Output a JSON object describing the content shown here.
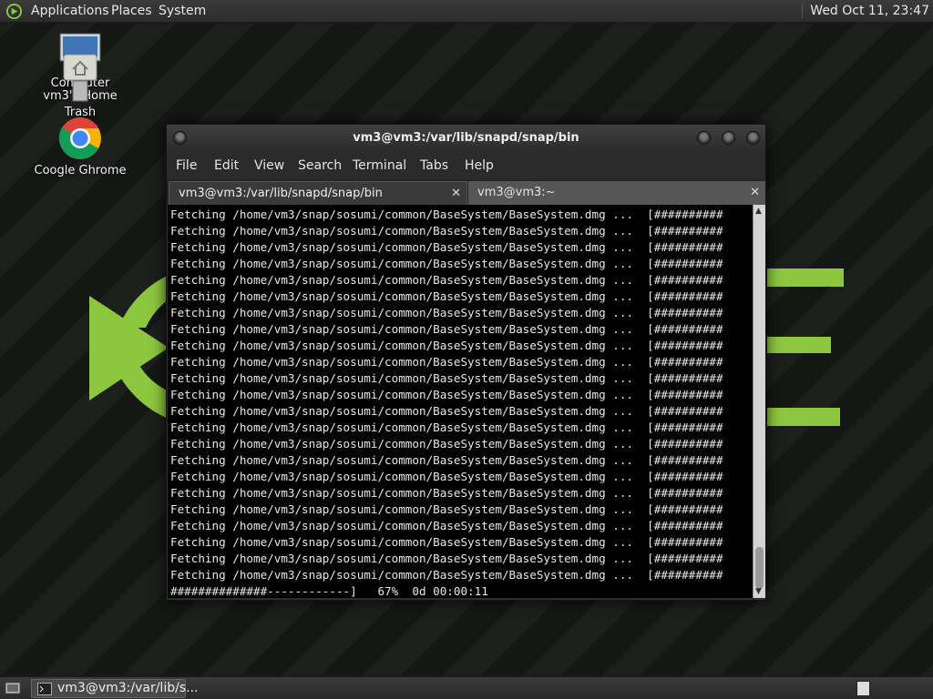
{
  "top_panel": {
    "applications": "Applications",
    "places": "Places",
    "system": "System",
    "clock": "Wed Oct 11, 23:47"
  },
  "desktop": {
    "computer_label": "Computer",
    "home_label": "vm3's Home",
    "trash_label": "Trash",
    "chrome_label": "Coogle Ghrome"
  },
  "terminal": {
    "title": "vm3@vm3:/var/lib/snapd/snap/bin",
    "menu": [
      "File",
      "Edit",
      "View",
      "Search",
      "Terminal",
      "Tabs",
      "Help"
    ],
    "tabs": [
      {
        "label": "vm3@vm3:/var/lib/snapd/snap/bin",
        "active": true
      },
      {
        "label": "vm3@vm3:~",
        "active": false
      }
    ],
    "lines": [
      "Fetching /home/vm3/snap/sosumi/common/BaseSystem/BaseSystem.dmg ...  [##########",
      "Fetching /home/vm3/snap/sosumi/common/BaseSystem/BaseSystem.dmg ...  [##########",
      "Fetching /home/vm3/snap/sosumi/common/BaseSystem/BaseSystem.dmg ...  [##########",
      "Fetching /home/vm3/snap/sosumi/common/BaseSystem/BaseSystem.dmg ...  [##########",
      "Fetching /home/vm3/snap/sosumi/common/BaseSystem/BaseSystem.dmg ...  [##########",
      "Fetching /home/vm3/snap/sosumi/common/BaseSystem/BaseSystem.dmg ...  [##########",
      "Fetching /home/vm3/snap/sosumi/common/BaseSystem/BaseSystem.dmg ...  [##########",
      "Fetching /home/vm3/snap/sosumi/common/BaseSystem/BaseSystem.dmg ...  [##########",
      "Fetching /home/vm3/snap/sosumi/common/BaseSystem/BaseSystem.dmg ...  [##########",
      "Fetching /home/vm3/snap/sosumi/common/BaseSystem/BaseSystem.dmg ...  [##########",
      "Fetching /home/vm3/snap/sosumi/common/BaseSystem/BaseSystem.dmg ...  [##########",
      "Fetching /home/vm3/snap/sosumi/common/BaseSystem/BaseSystem.dmg ...  [##########",
      "Fetching /home/vm3/snap/sosumi/common/BaseSystem/BaseSystem.dmg ...  [##########",
      "Fetching /home/vm3/snap/sosumi/common/BaseSystem/BaseSystem.dmg ...  [##########",
      "Fetching /home/vm3/snap/sosumi/common/BaseSystem/BaseSystem.dmg ...  [##########",
      "Fetching /home/vm3/snap/sosumi/common/BaseSystem/BaseSystem.dmg ...  [##########",
      "Fetching /home/vm3/snap/sosumi/common/BaseSystem/BaseSystem.dmg ...  [##########",
      "Fetching /home/vm3/snap/sosumi/common/BaseSystem/BaseSystem.dmg ...  [##########",
      "Fetching /home/vm3/snap/sosumi/common/BaseSystem/BaseSystem.dmg ...  [##########",
      "Fetching /home/vm3/snap/sosumi/common/BaseSystem/BaseSystem.dmg ...  [##########",
      "Fetching /home/vm3/snap/sosumi/common/BaseSystem/BaseSystem.dmg ...  [##########",
      "Fetching /home/vm3/snap/sosumi/common/BaseSystem/BaseSystem.dmg ...  [##########",
      "Fetching /home/vm3/snap/sosumi/common/BaseSystem/BaseSystem.dmg ...  [##########",
      "##############------------]   67%  0d 00:00:11"
    ]
  },
  "bottom_panel": {
    "task_label": "vm3@vm3:/var/lib/s..."
  },
  "colors": {
    "accent_green": "#8dc63f",
    "terminal_bg": "#000000",
    "terminal_fg": "#e8e8e8"
  }
}
